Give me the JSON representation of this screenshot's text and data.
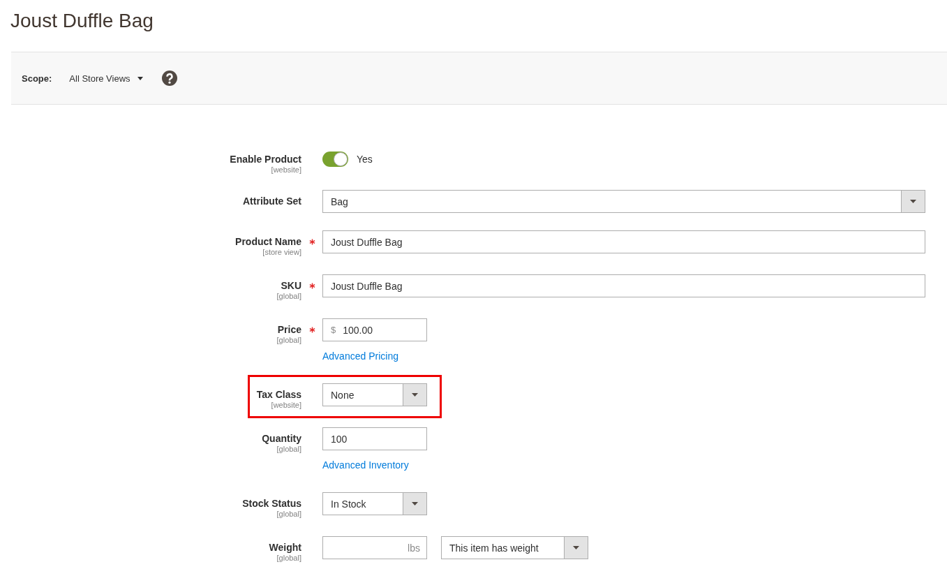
{
  "page_title": "Joust Duffle Bag",
  "scope_bar": {
    "label": "Scope:",
    "value": "All Store Views"
  },
  "fields": [
    {
      "kind": "toggle",
      "label": "Enable Product",
      "scope": "[website]",
      "required": false,
      "highlighted": false,
      "on": true,
      "value": "Yes"
    },
    {
      "kind": "wide-select",
      "label": "Attribute Set",
      "required": false,
      "highlighted": false,
      "value": "Bag"
    },
    {
      "kind": "wide-input",
      "label": "Product Name",
      "scope": "[store view]",
      "required": true,
      "highlighted": false,
      "value": "Joust Duffle Bag"
    },
    {
      "kind": "wide-input",
      "label": "SKU",
      "scope": "[global]",
      "required": true,
      "highlighted": false,
      "value": "Joust Duffle Bag"
    },
    {
      "kind": "price",
      "label": "Price",
      "scope": "[global]",
      "required": true,
      "highlighted": false,
      "currency": "$",
      "value": "100.00",
      "link": "Advanced Pricing"
    },
    {
      "kind": "select",
      "label": "Tax Class",
      "scope": "[website]",
      "required": false,
      "highlighted": true,
      "value": "None"
    },
    {
      "kind": "input",
      "label": "Quantity",
      "scope": "[global]",
      "required": false,
      "highlighted": false,
      "value": "100",
      "link": "Advanced Inventory"
    },
    {
      "kind": "select",
      "label": "Stock Status",
      "scope": "[global]",
      "required": false,
      "highlighted": false,
      "value": "In Stock"
    },
    {
      "kind": "weight",
      "label": "Weight",
      "scope": "[global]",
      "required": false,
      "highlighted": false,
      "unit": "lbs",
      "option": "This item has weight"
    }
  ]
}
